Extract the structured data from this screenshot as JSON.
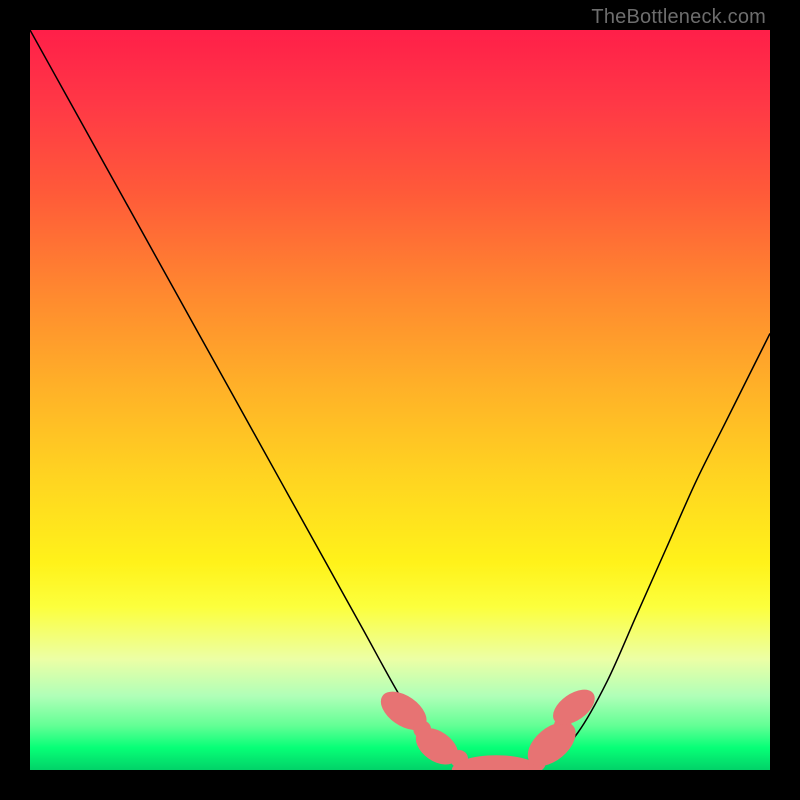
{
  "watermark": "TheBottleneck.com",
  "colors": {
    "frame": "#000000",
    "marker": "#e77373",
    "curve": "#000000"
  },
  "chart_data": {
    "type": "line",
    "title": "",
    "xlabel": "",
    "ylabel": "",
    "xlim": [
      0,
      100
    ],
    "ylim": [
      0,
      100
    ],
    "grid": false,
    "legend": false,
    "series": [
      {
        "name": "bottleneck-curve",
        "x": [
          0,
          5,
          10,
          15,
          20,
          25,
          30,
          35,
          40,
          45,
          50,
          54,
          58,
          62,
          66,
          70,
          74,
          78,
          82,
          86,
          90,
          94,
          98,
          100
        ],
        "y": [
          100,
          91,
          82,
          73,
          64,
          55,
          46,
          37,
          28,
          19,
          10,
          4,
          1,
          0,
          0,
          1,
          5,
          12,
          21,
          30,
          39,
          47,
          55,
          59
        ]
      }
    ],
    "annotations": {
      "low_region_markers": [
        {
          "shape": "pill",
          "cx": 50.5,
          "cy": 8,
          "rx": 2.0,
          "ry": 3.5,
          "angle": -55
        },
        {
          "shape": "dot",
          "cx": 53.0,
          "cy": 5.5,
          "r": 1.2
        },
        {
          "shape": "pill",
          "cx": 55.0,
          "cy": 3.2,
          "rx": 2.0,
          "ry": 3.2,
          "angle": -55
        },
        {
          "shape": "dot",
          "cx": 58.0,
          "cy": 1.5,
          "r": 1.2
        },
        {
          "shape": "pill",
          "cx": 63.0,
          "cy": 0.0,
          "rx": 6.0,
          "ry": 2.0,
          "angle": 0
        },
        {
          "shape": "dot",
          "cx": 68.5,
          "cy": 1.0,
          "r": 1.2
        },
        {
          "shape": "pill",
          "cx": 70.5,
          "cy": 3.5,
          "rx": 2.2,
          "ry": 3.8,
          "angle": 50
        },
        {
          "shape": "dot",
          "cx": 72.0,
          "cy": 6.0,
          "r": 1.2
        },
        {
          "shape": "pill",
          "cx": 73.5,
          "cy": 8.5,
          "rx": 1.8,
          "ry": 3.2,
          "angle": 55
        }
      ]
    }
  }
}
